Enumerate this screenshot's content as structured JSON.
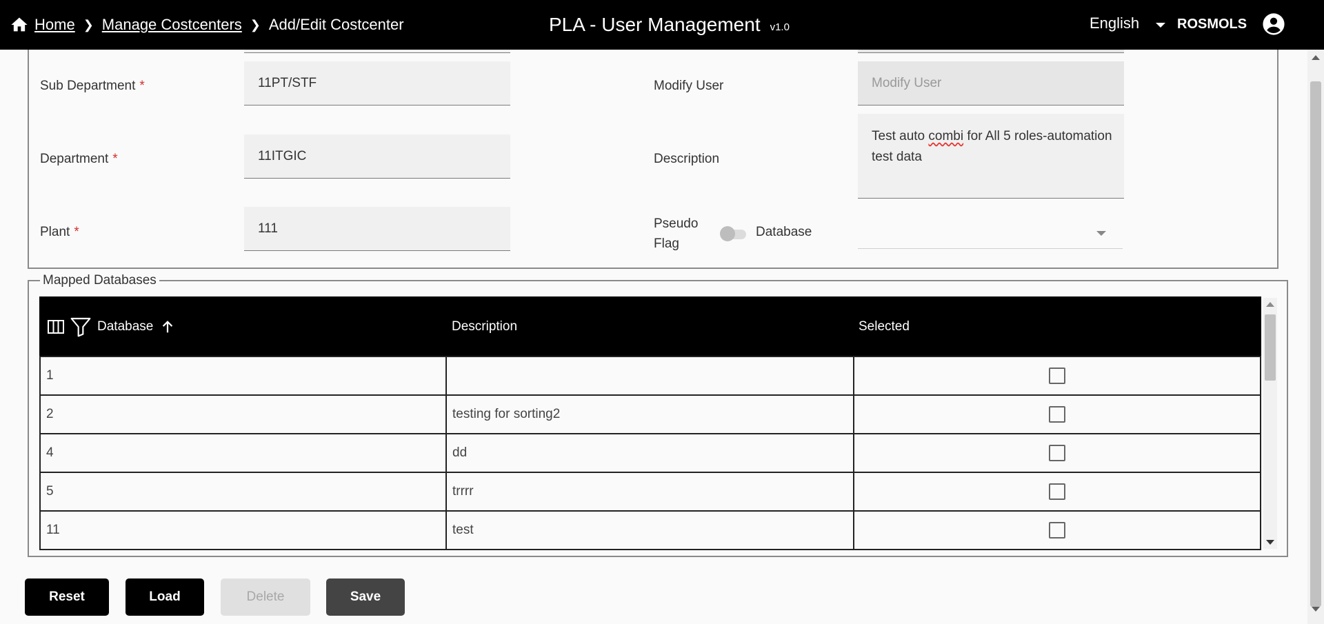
{
  "header": {
    "breadcrumbs": [
      "Home",
      "Manage Costcenters",
      "Add/Edit Costcenter"
    ],
    "separator": "❯",
    "title": "PLA - User Management",
    "version": "v1.0",
    "language": "English",
    "user": "ROSMOLS"
  },
  "form": {
    "sub_department": {
      "label": "Sub Department",
      "required": "*",
      "value": "11PT/STF"
    },
    "department": {
      "label": "Department",
      "required": "*",
      "value": "11ITGIC"
    },
    "plant": {
      "label": "Plant",
      "required": "*",
      "value": "111"
    },
    "modify_user": {
      "label": "Modify User",
      "placeholder": "Modify User"
    },
    "description": {
      "label": "Description",
      "value_pre": "Test auto ",
      "value_spell": "combi",
      "value_post": " for All 5 roles-automation test data"
    },
    "pseudo_flag": {
      "label_line1": "Pseudo",
      "label_line2": "Flag",
      "value": false
    },
    "database": {
      "label": "Database",
      "value": ""
    }
  },
  "mapped": {
    "legend": "Mapped Databases",
    "columns": [
      "Database",
      "Description",
      "Selected"
    ],
    "sort": "ascending",
    "rows": [
      {
        "database": "1",
        "description": "",
        "selected": false
      },
      {
        "database": "2",
        "description": "testing for sorting2",
        "selected": false
      },
      {
        "database": "4",
        "description": "dd",
        "selected": false
      },
      {
        "database": "5",
        "description": "trrrr",
        "selected": false
      },
      {
        "database": "11",
        "description": "test",
        "selected": false
      }
    ]
  },
  "buttons": {
    "reset": "Reset",
    "load": "Load",
    "delete": "Delete",
    "save": "Save"
  }
}
